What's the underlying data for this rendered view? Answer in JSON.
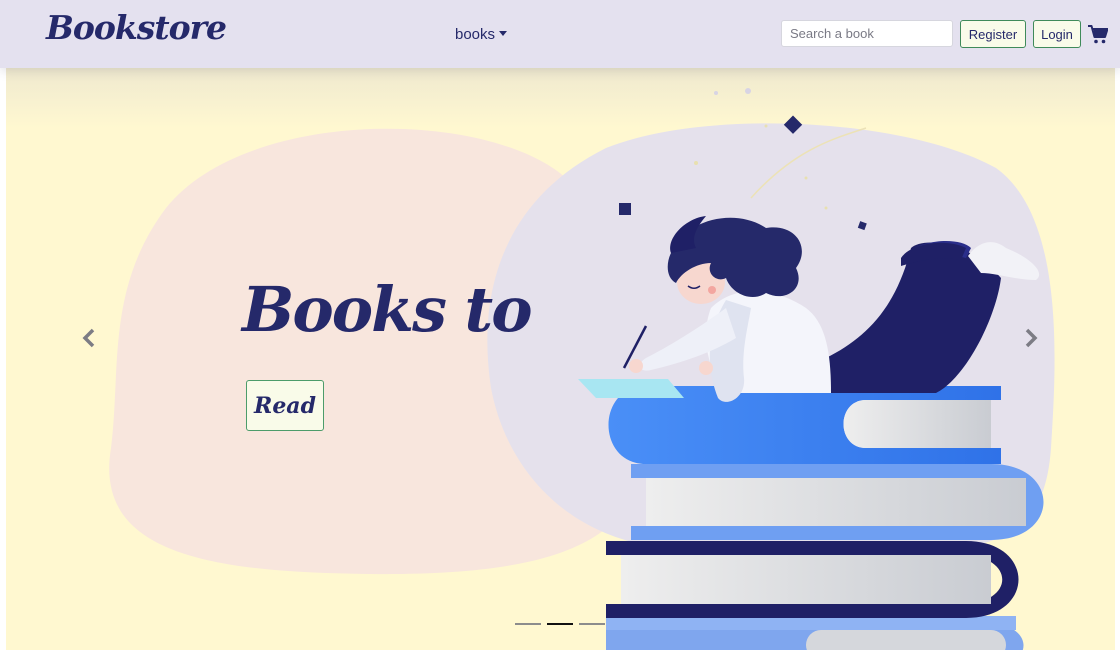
{
  "navbar": {
    "brand": "Bookstore",
    "menu_label": "books",
    "search_placeholder": "Search a book",
    "register_label": "Register",
    "login_label": "Login",
    "cart_icon": "shopping-cart-icon"
  },
  "hero": {
    "title": "Books to",
    "button_label": "Read",
    "prev_icon": "chevron-left-icon",
    "next_icon": "chevron-right-icon",
    "active_slide": 2,
    "slide_count": 3
  },
  "colors": {
    "navbar_bg": "#e4e1ef",
    "brand": "#25296a",
    "hero_bg": "#fff8d0",
    "button_border": "#3f8a5a",
    "button_bg": "#f9fbe9",
    "book_blue": "#3b82f6"
  }
}
